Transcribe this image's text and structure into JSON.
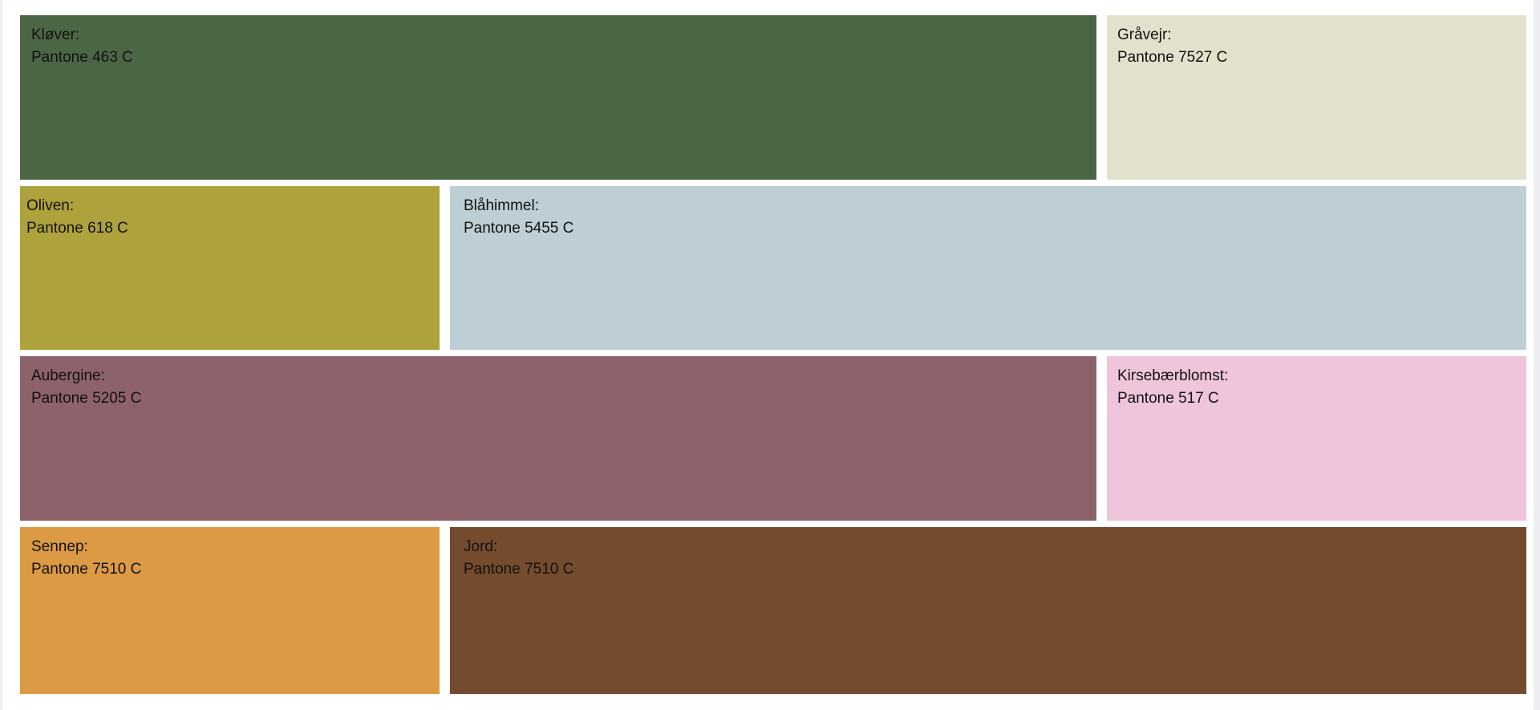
{
  "swatches": [
    {
      "name": "Kløver:",
      "code": "Pantone 463 C",
      "color": "#4b6645"
    },
    {
      "name": "Gråvejr:",
      "code": "Pantone 7527 C",
      "color": "#e2e1cc"
    },
    {
      "name": "Oliven:",
      "code": "Pantone 618 C",
      "color": "#aea23d"
    },
    {
      "name": "Blåhimmel:",
      "code": "Pantone 5455 C",
      "color": "#bdcfd5"
    },
    {
      "name": "Aubergine:",
      "code": "Pantone 5205 C",
      "color": "#8d626b"
    },
    {
      "name": "Kirsebærblomst:",
      "code": "Pantone 517 C",
      "color": "#efc5dc"
    },
    {
      "name": "Sennep:",
      "code": "Pantone 7510 C",
      "color": "#db9a43"
    },
    {
      "name": "Jord:",
      "code": "Pantone 7510 C",
      "color": "#744b2d"
    }
  ]
}
